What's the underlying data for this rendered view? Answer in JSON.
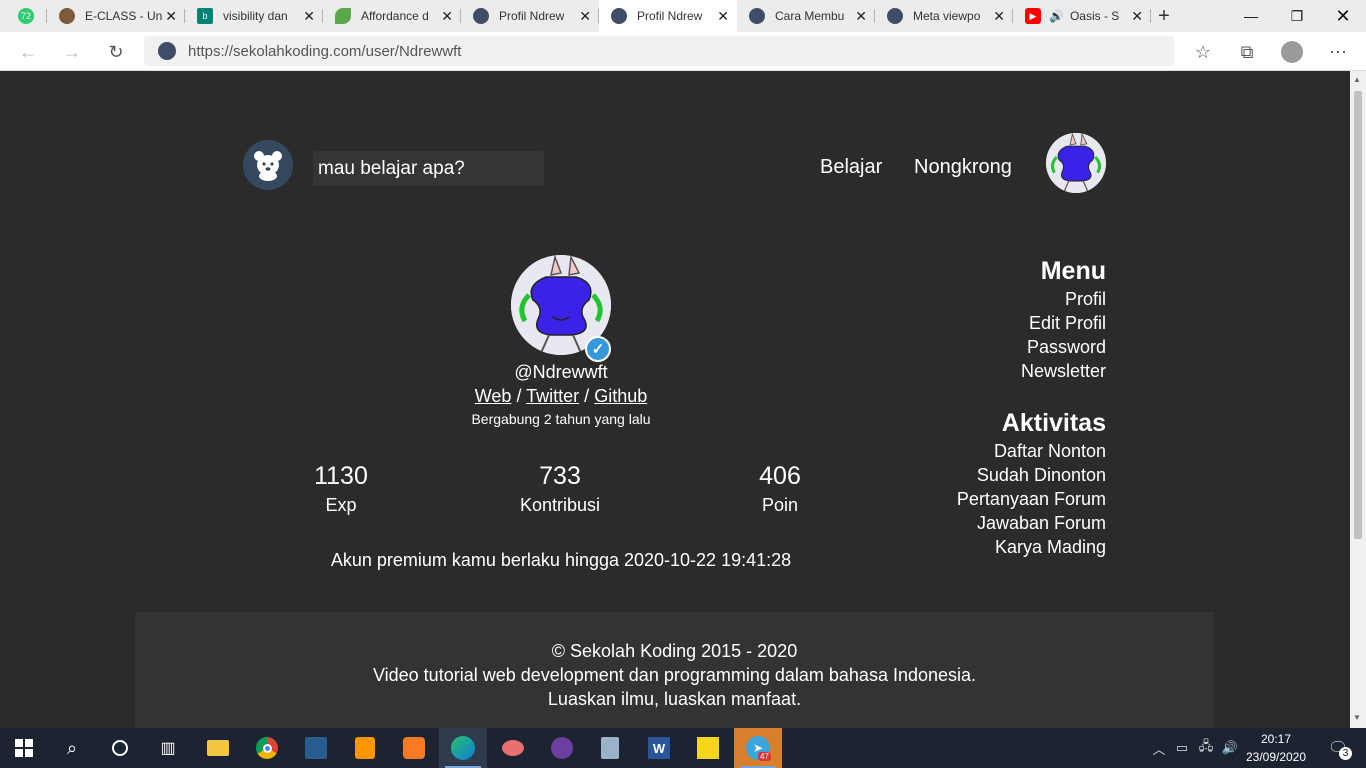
{
  "browser": {
    "tabs": [
      {
        "title": "",
        "favicon": "green-badge-icon",
        "count": "72"
      },
      {
        "title": "E-CLASS - Un",
        "favicon": "eclass-icon"
      },
      {
        "title": "visibility dan",
        "favicon": "bing-icon"
      },
      {
        "title": "Affordance d",
        "favicon": "leaf-icon"
      },
      {
        "title": "Profil Ndrew",
        "favicon": "sekolahkoding-icon"
      },
      {
        "title": "Profil Ndrew",
        "favicon": "sekolahkoding-icon",
        "active": true
      },
      {
        "title": "Cara Membu",
        "favicon": "sekolahkoding-icon"
      },
      {
        "title": "Meta viewpo",
        "favicon": "sekolahkoding-icon"
      },
      {
        "title": "Oasis - S",
        "favicon": "youtube-icon"
      }
    ],
    "url": "https://sekolahkoding.com/user/Ndrewwft"
  },
  "header": {
    "search_placeholder": "mau belajar apa?",
    "nav": [
      "Belajar",
      "Nongkrong"
    ]
  },
  "profile": {
    "username": "@Ndrewwft",
    "links": [
      "Web",
      "Twitter",
      "Github"
    ],
    "separator": "/",
    "joined": "Bergabung 2 tahun yang lalu",
    "stats": [
      {
        "value": "1130",
        "label": "Exp"
      },
      {
        "value": "733",
        "label": "Kontribusi"
      },
      {
        "value": "406",
        "label": "Poin"
      }
    ],
    "premium": "Akun premium kamu berlaku hingga 2020-10-22 19:41:28"
  },
  "sidebar": {
    "menu_title": "Menu",
    "menu_items": [
      "Profil",
      "Edit Profil",
      "Password",
      "Newsletter"
    ],
    "activity_title": "Aktivitas",
    "activity_items": [
      "Daftar Nonton",
      "Sudah Dinonton",
      "Pertanyaan Forum",
      "Jawaban Forum",
      "Karya Mading"
    ]
  },
  "footer": {
    "copyright": "© Sekolah Koding 2015 - 2020",
    "tagline": "Video tutorial web development dan programming dalam bahasa Indonesia.",
    "motto": "Luaskan ilmu, luaskan manfaat."
  },
  "taskbar": {
    "time": "20:17",
    "date": "23/09/2020",
    "notifications": "3",
    "telegram_badge": "47"
  },
  "colors": {
    "page_bg": "#2b2b2b",
    "footer_bg": "#333333",
    "logo_bg": "#34495e",
    "avatar_blob": "#3b22e8",
    "verified": "#3498db"
  }
}
